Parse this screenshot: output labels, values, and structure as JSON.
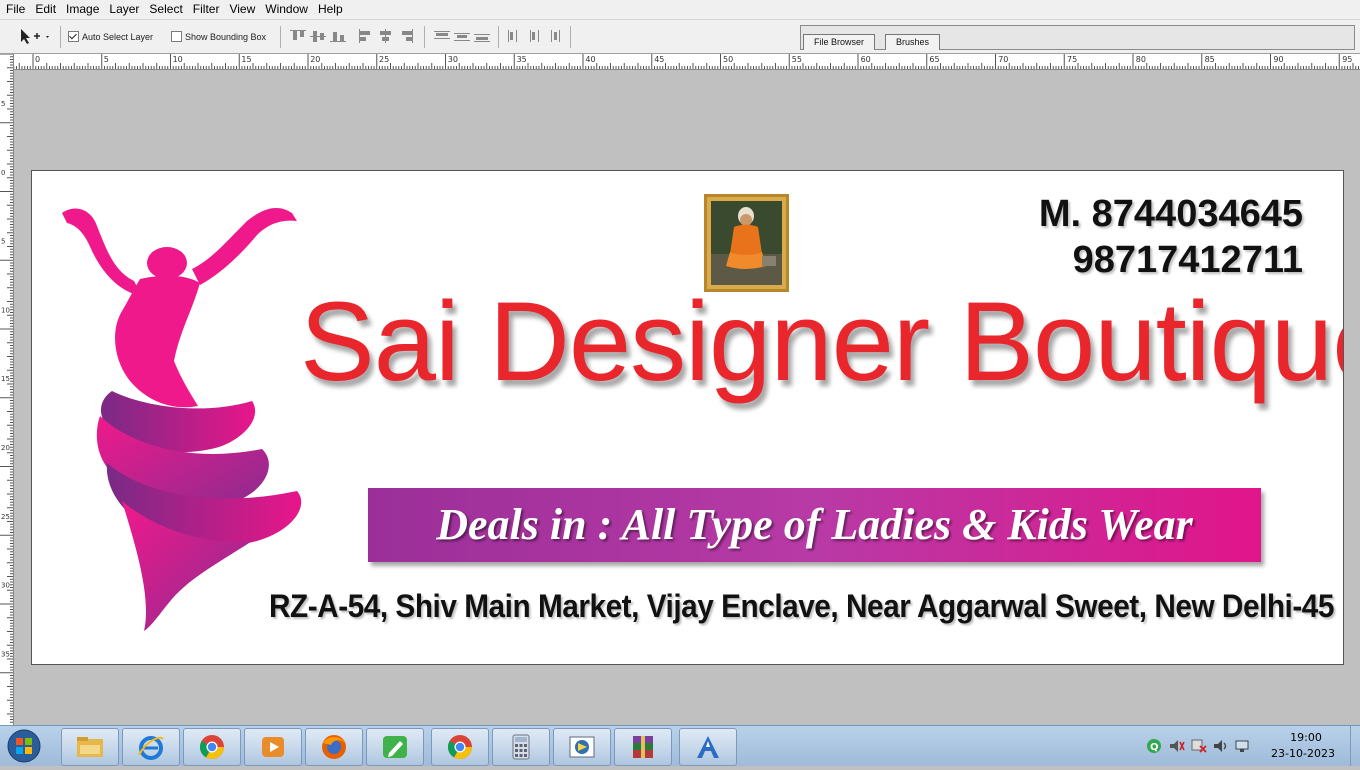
{
  "menu": [
    "File",
    "Edit",
    "Image",
    "Layer",
    "Select",
    "Filter",
    "View",
    "Window",
    "Help"
  ],
  "options": {
    "auto_select_label": "Auto Select Layer",
    "auto_select_checked": true,
    "bounding_box_label": "Show Bounding Box",
    "bounding_box_checked": false
  },
  "palette_tabs": [
    "File Browser",
    "Brushes"
  ],
  "ruler": {
    "top_labels": [
      "0",
      "5",
      "10",
      "15",
      "20",
      "25",
      "30",
      "35",
      "40",
      "45",
      "50",
      "55",
      "60",
      "65",
      "70",
      "75",
      "80",
      "85",
      "90",
      "95"
    ],
    "left_labels": [
      "5",
      "0",
      "5",
      "10",
      "15",
      "20",
      "25",
      "30",
      "35"
    ]
  },
  "canvas": {
    "phone1": "M. 8744034645",
    "phone2": "98717412711",
    "title": "Sai Designer Boutique",
    "deals": "Deals in : All Type of Ladies & Kids Wear",
    "address": "RZ-A-54, Shiv Main Market, Vijay Enclave, Near Aggarwal Sweet, New Delhi-45",
    "colors": {
      "title": "#e8262c",
      "banner_start": "#9b2f99",
      "banner_end": "#e1158a",
      "logo": "#f0198c"
    }
  },
  "taskbar": {
    "apps": [
      "file-explorer-icon",
      "internet-explorer-icon",
      "chrome-icon",
      "media-player-icon",
      "firefox-icon",
      "notepad-icon",
      "chrome-alt-icon",
      "calculator-icon",
      "photo-viewer-icon",
      "winrar-icon",
      "app-a-icon"
    ],
    "time": "19:00",
    "date": "23-10-2023"
  }
}
